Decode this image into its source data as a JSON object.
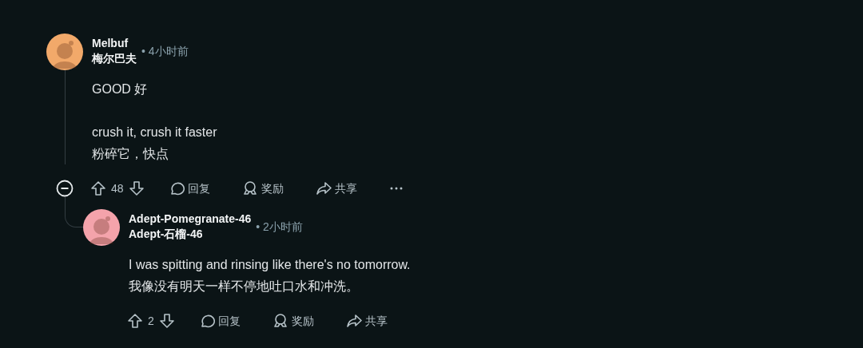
{
  "comments": [
    {
      "username": "Melbuf",
      "username_translation": "梅尔巴夫",
      "time": "• 4小时前",
      "color": "#f2a96a",
      "body": [
        [
          "GOOD 好"
        ],
        [
          "crush it, crush it faster",
          "粉碎它，快点"
        ]
      ],
      "score": "48",
      "actions": [
        {
          "kind": "reply",
          "label": "回复"
        },
        {
          "kind": "award",
          "label": "奖励"
        },
        {
          "kind": "share",
          "label": "共享"
        },
        {
          "kind": "more"
        }
      ],
      "replies": [
        {
          "username": "Adept-Pomegranate-46",
          "username_translation": "Adept-石榴-46",
          "time": "• 2小时前",
          "color": "#f4a3ab",
          "body": [
            [
              "I was spitting and rinsing like there's no tomorrow.",
              "我像没有明天一样不停地吐口水和冲洗。"
            ]
          ],
          "score": "2",
          "actions": [
            {
              "kind": "reply",
              "label": "回复"
            },
            {
              "kind": "award",
              "label": "奖励"
            },
            {
              "kind": "share",
              "label": "共享"
            }
          ]
        }
      ]
    }
  ]
}
